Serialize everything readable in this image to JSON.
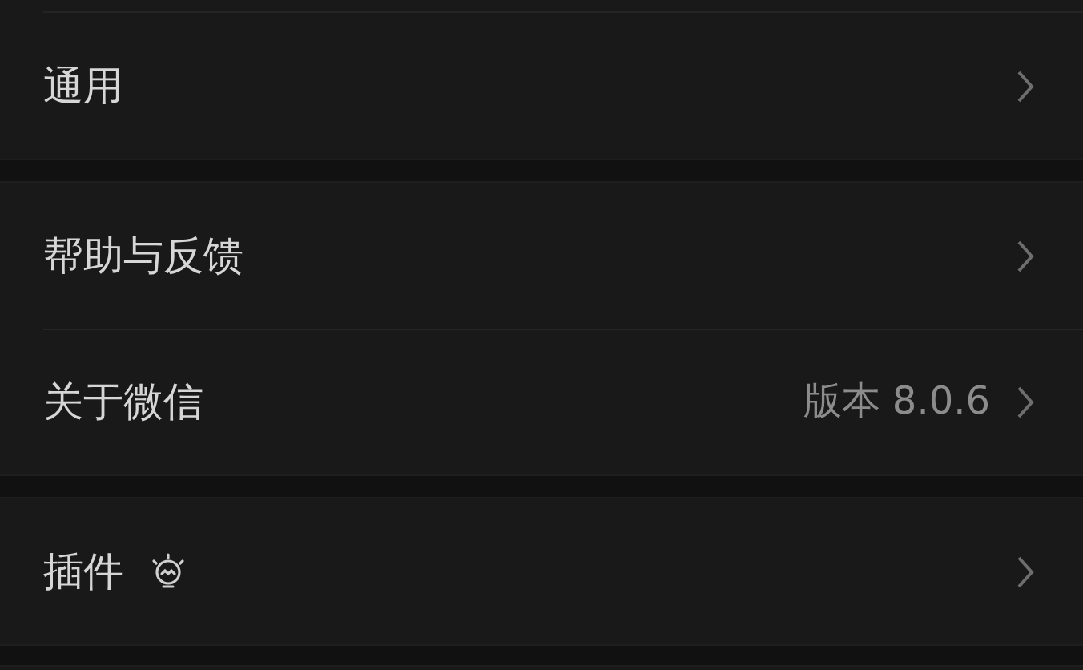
{
  "groups": [
    {
      "items": [
        {
          "kind": "plain",
          "label": "通用"
        }
      ]
    },
    {
      "items": [
        {
          "kind": "plain",
          "label": "帮助与反馈"
        },
        {
          "kind": "plain",
          "label": "关于微信",
          "value": "版本 8.0.6"
        }
      ]
    },
    {
      "items": [
        {
          "kind": "with-icon",
          "label": "插件"
        }
      ]
    }
  ]
}
